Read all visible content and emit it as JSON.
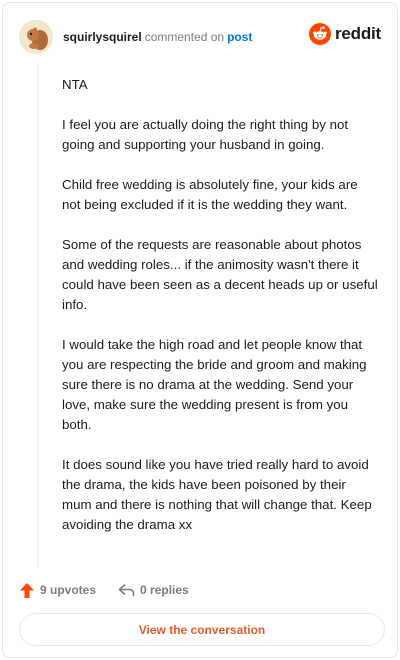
{
  "header": {
    "username": "squirlysquirel",
    "action_text": "commented on",
    "post_link": "post",
    "brand_name": "reddit"
  },
  "comment": {
    "paragraphs": [
      "NTA",
      "I feel you are actually doing the right thing by not going and supporting your husband in going.",
      "Child free wedding is absolutely fine, your kids are not being excluded if it is the wedding they want.",
      "Some of the requests are reasonable about photos and wedding roles... if the animosity wasn't there it could have been seen as a decent heads up or useful info.",
      "I would take the high road and let people know that you are respecting the bride and groom and making sure there is no drama at the wedding. Send your love, make sure the wedding present is from you both.",
      "It does sound like you have tried really hard to avoid the drama, the kids have been poisoned by their mum and there is nothing that will change that. Keep avoiding the drama xx"
    ]
  },
  "footer": {
    "upvotes_label": "9 upvotes",
    "replies_label": "0 replies",
    "conversation_button": "View the conversation"
  },
  "colors": {
    "brand_orange": "#ff4500",
    "link_blue": "#0079d3",
    "button_text": "#e25b2a"
  },
  "icons": {
    "avatar": "squirrel-avatar",
    "brand": "reddit-logo-icon",
    "upvote": "upvote-arrow-icon",
    "reply": "reply-arrow-icon"
  }
}
